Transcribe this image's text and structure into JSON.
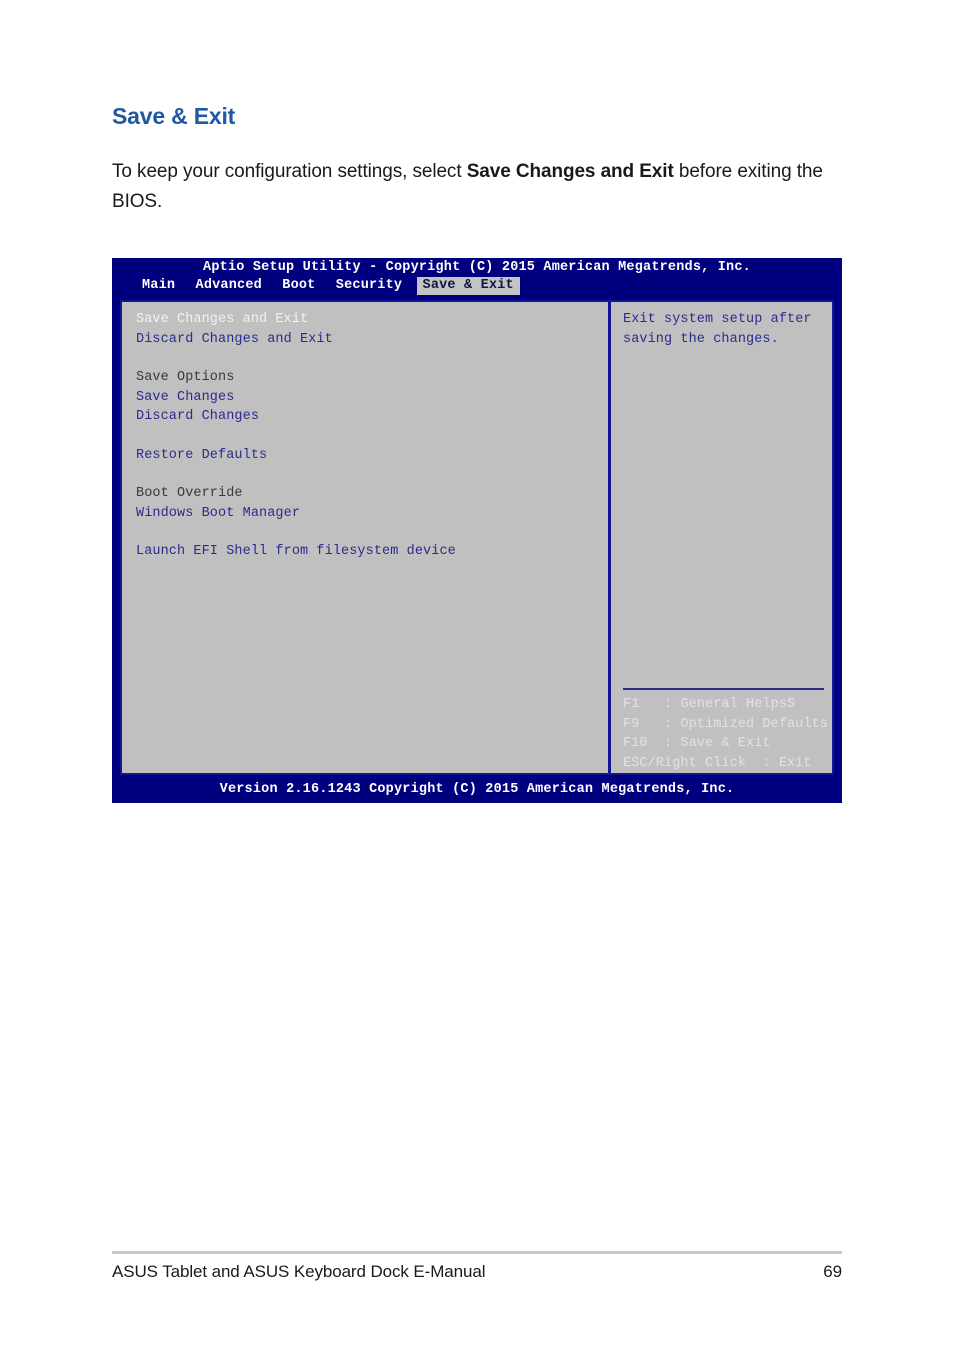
{
  "document": {
    "title": "Save & Exit",
    "intro_before": "To keep your configuration settings, select ",
    "intro_bold": "Save Changes and Exit",
    "intro_after": " before exiting the BIOS."
  },
  "bios": {
    "banner": "Aptio Setup Utility - Copyright (C) 2015 American Megatrends, Inc.",
    "tabs": [
      {
        "label": "Main",
        "active": false
      },
      {
        "label": "Advanced",
        "active": false
      },
      {
        "label": "Boot",
        "active": false
      },
      {
        "label": "Security",
        "active": false
      },
      {
        "label": "Save & Exit",
        "active": true
      }
    ],
    "menu": [
      {
        "label": "Save Changes and Exit",
        "style": "selected"
      },
      {
        "label": "Discard Changes and Exit",
        "style": "link"
      },
      {
        "label": "",
        "style": "spacer"
      },
      {
        "label": "Save Options",
        "style": "heading"
      },
      {
        "label": "Save Changes",
        "style": "link"
      },
      {
        "label": "Discard Changes",
        "style": "link"
      },
      {
        "label": "",
        "style": "spacer"
      },
      {
        "label": "Restore Defaults",
        "style": "link"
      },
      {
        "label": "",
        "style": "spacer"
      },
      {
        "label": "Boot Override",
        "style": "heading"
      },
      {
        "label": "Windows Boot Manager",
        "style": "link"
      },
      {
        "label": "",
        "style": "spacer"
      },
      {
        "label": "Launch EFI Shell from filesystem device",
        "style": "link"
      }
    ],
    "help": [
      "Exit system setup after",
      "saving the changes."
    ],
    "keys": [
      "F1   : General HelpsS",
      "F9   : Optimized Defaults",
      "F10  : Save & Exit",
      "ESC/Right Click  : Exit"
    ],
    "footer": "Version 2.16.1243 Copyright (C) 2015 American Megatrends, Inc.",
    "colors": {
      "chrome": "#00007e",
      "panel": "#c0c0c0",
      "border": "#15159a",
      "link": "#2b2b8f",
      "selected": "#f2f2f2"
    }
  },
  "page_footer": {
    "manual": "ASUS Tablet and ASUS Keyboard Dock E-Manual",
    "page_number": "69"
  }
}
